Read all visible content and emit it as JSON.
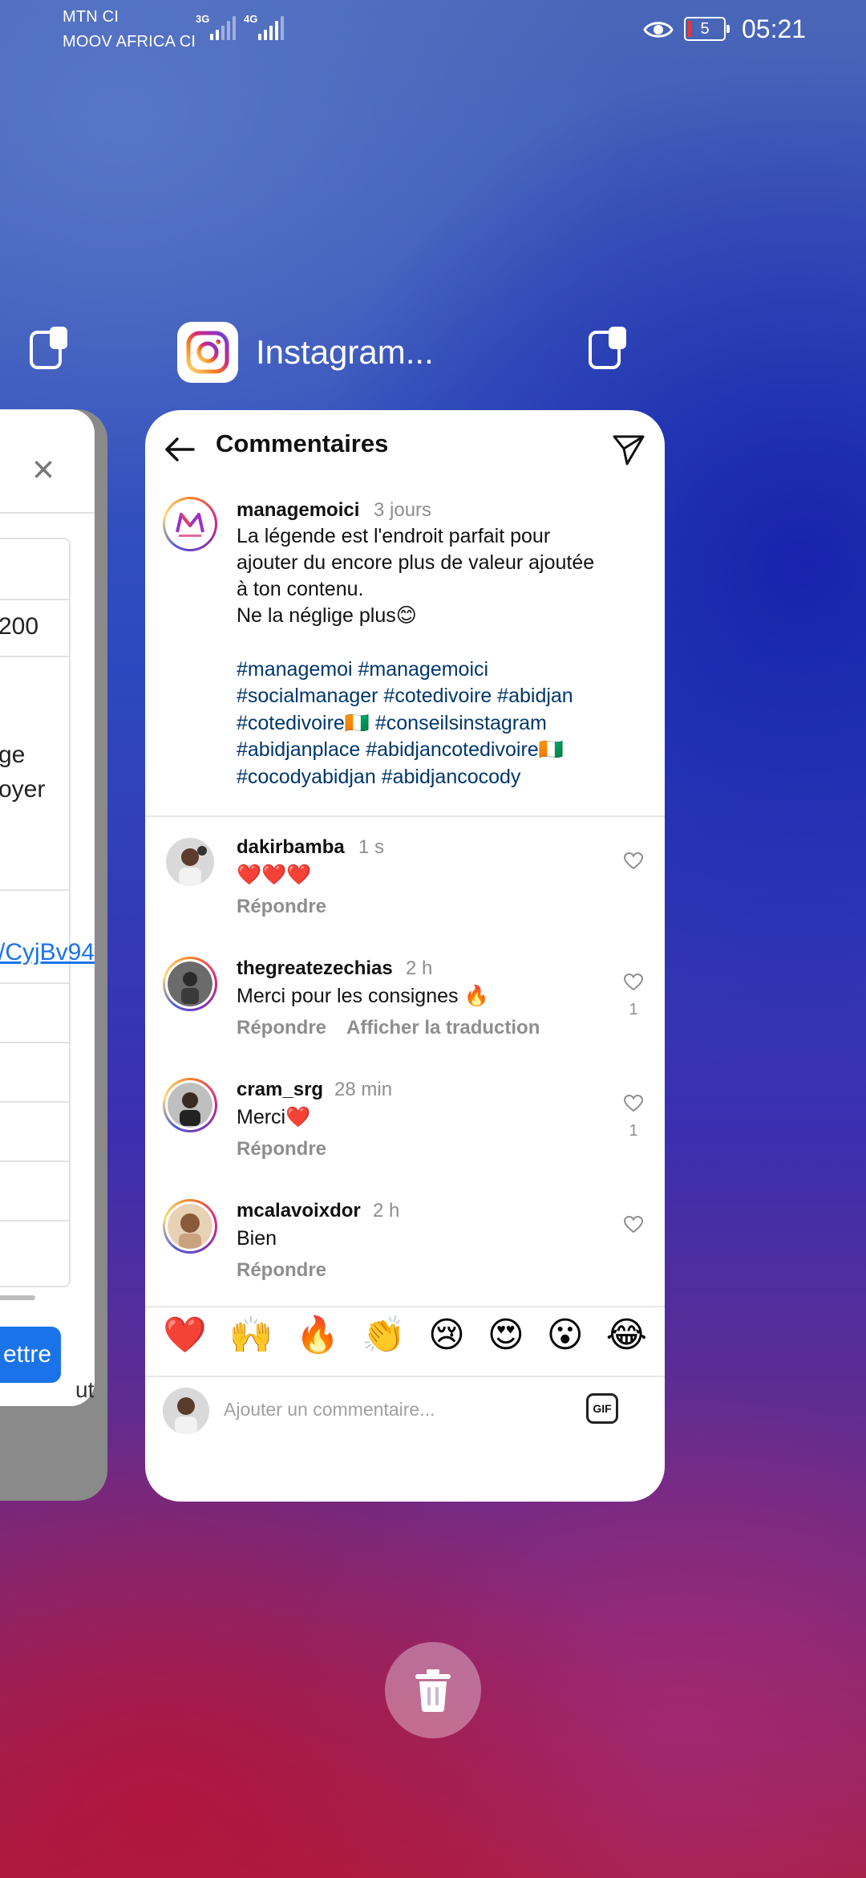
{
  "status_bar": {
    "carrier1": "MTN CI",
    "carrier2": "MOOV AFRICA CI",
    "net1": "3G",
    "net2": "4G",
    "battery": "5",
    "time": "05:21"
  },
  "recents": {
    "app_title": "Instagram...",
    "left_card": {
      "value": "200",
      "line1": "ge",
      "line2": "oyer",
      "link": "/CyjBv94",
      "button": "ettre",
      "peek": "ut"
    }
  },
  "instagram": {
    "header_title": "Commentaires",
    "post": {
      "username": "managemoici",
      "time": "3 jours",
      "lines": [
        "La légende est l'endroit parfait pour",
        "ajouter du encore plus de valeur ajoutée",
        "à ton contenu.",
        "Ne la néglige plus😊"
      ],
      "hashtags": [
        "#managemoi #managemoici",
        "#socialmanager #cotedivoire #abidjan",
        "#cotedivoire🇨🇮 #conseilsinstagram",
        "#abidjanplace #abidjancotedivoire🇨🇮",
        "#cocodyabidjan #abidjancocody"
      ]
    },
    "comments": [
      {
        "username": "dakirbamba",
        "time": "1 s",
        "text": "❤️❤️❤️",
        "reply": "Répondre",
        "likes": ""
      },
      {
        "username": "thegreatezechias",
        "time": "2 h",
        "text": "Merci pour les consignes 🔥",
        "reply": "Répondre",
        "translate": "Afficher la traduction",
        "likes": "1"
      },
      {
        "username": "cram_srg",
        "time": "28 min",
        "text": "Merci❤️",
        "reply": "Répondre",
        "likes": "1"
      },
      {
        "username": "mcalavoixdor",
        "time": "2 h",
        "text": "Bien",
        "reply": "Répondre",
        "likes": ""
      }
    ],
    "reactions": [
      "❤️",
      "🙌",
      "🔥",
      "👏",
      "😢",
      "😍",
      "😮",
      "😂"
    ],
    "comment_placeholder": "Ajouter un commentaire...",
    "gif_label": "GIF"
  },
  "icons": {
    "back": "back-arrow-icon",
    "send": "send-icon",
    "heart": "heart-icon",
    "trash": "trash-icon",
    "split": "split-screen-icon",
    "eye": "eye-comfort-icon"
  }
}
